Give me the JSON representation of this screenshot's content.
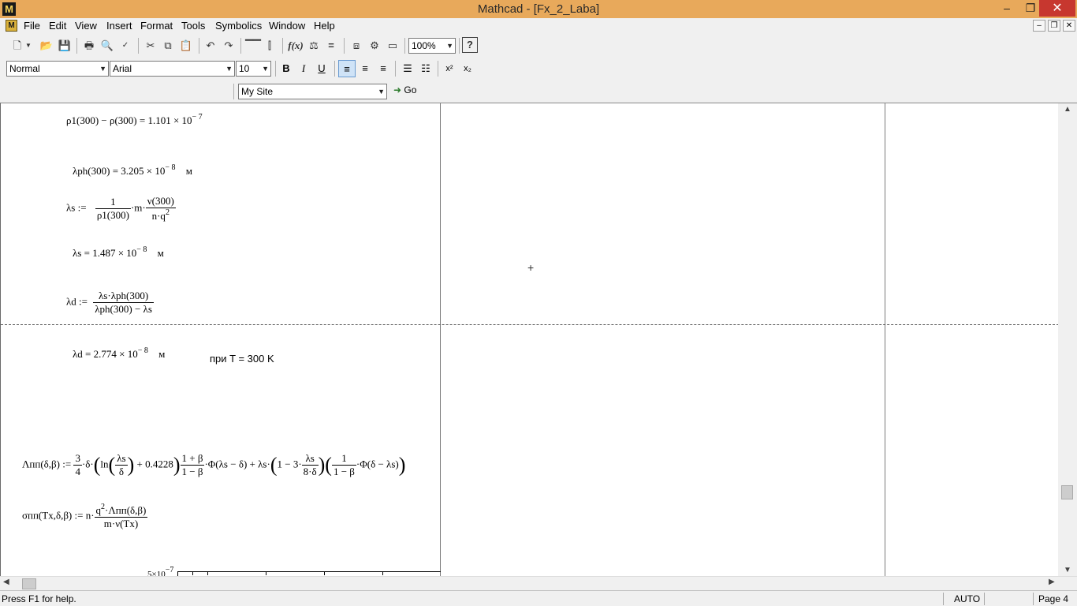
{
  "window": {
    "title": "Mathcad - [Fx_2_Laba]",
    "app_icon": "M",
    "controls": {
      "minimize": "–",
      "maximize": "❐",
      "close": "✕"
    }
  },
  "menu": {
    "doc_icon": "M",
    "items": [
      "File",
      "Edit",
      "View",
      "Insert",
      "Format",
      "Tools",
      "Symbolics",
      "Window",
      "Help"
    ],
    "mdi": {
      "minimize": "–",
      "restore": "❐",
      "close": "✕"
    }
  },
  "toolbar": {
    "icons": [
      "new-icon",
      "dropdown-icon",
      "open-icon",
      "save-icon",
      "print-icon",
      "print-preview-icon",
      "spell-check-icon",
      "cut-icon",
      "copy-icon",
      "paste-icon",
      "undo-icon",
      "redo-icon",
      "align-across-icon",
      "align-down-icon",
      "insert-function-icon",
      "insert-unit-icon",
      "calculate-icon",
      "insert-component-icon",
      "resource-center-icon",
      "help-icon"
    ],
    "zoom": "100%"
  },
  "format_bar": {
    "style": "Normal",
    "font": "Arial",
    "size": "10",
    "bold": "B",
    "italic": "I",
    "underline": "U",
    "superscript": "x²",
    "subscript": "x₂"
  },
  "web_bar": {
    "site": "My Site",
    "go_label": "Go"
  },
  "document": {
    "eq1_text": "ρ1(300) − ρ(300) = 1.101 × 10",
    "eq1_exp": "− 7",
    "eq2_text": "λph(300) = 3.205 × 10",
    "eq2_exp": "− 8",
    "eq2_unit": "м",
    "eq3_lhs": "λs :=",
    "eq3_num1": "1",
    "eq3_den1": "ρ1(300)",
    "eq3_mid": "·m·",
    "eq3_num2": "ν(300)",
    "eq3_den2": "n·q",
    "eq3_den2_exp": "2",
    "eq4_text": "λs = 1.487 × 10",
    "eq4_exp": "− 8",
    "eq4_unit": "м",
    "eq5_lhs": "λd :=",
    "eq5_num": "λs·λph(300)",
    "eq5_den": "λph(300) − λs",
    "eq6_text": "λd = 2.774 × 10",
    "eq6_exp": "− 8",
    "eq6_unit": "м",
    "note": "при T = 300 K",
    "eq7_lhs": "Λпп(δ,β) :=",
    "eq7_f1_num": "3",
    "eq7_f1_den": "4",
    "eq7_p1": "·δ·",
    "eq7_ln": "ln",
    "eq7_f2_num": "λs",
    "eq7_f2_den": "δ",
    "eq7_p2": "+ 0.4228",
    "eq7_f3_num": "1 + β",
    "eq7_f3_den": "1 − β",
    "eq7_p3": "·Φ(λs − δ) + λs·",
    "eq7_p4": "1 − 3·",
    "eq7_f4_num": "λs",
    "eq7_f4_den": "8·δ",
    "eq7_f5_num": "1",
    "eq7_f5_den": "1 − β",
    "eq7_p5": "·Φ(δ − λs)",
    "eq8_lhs": "σпп(Tx,δ,β) := n·",
    "eq8_num": "q",
    "eq8_num_exp": "2",
    "eq8_num_rest": "·Λпп(δ,β)",
    "eq8_den": "m·ν(Tx)",
    "plot_label": "5×10",
    "plot_label_exp": "−7",
    "cursor": "+"
  },
  "status": {
    "help": "Press F1 for help.",
    "mode": "AUTO",
    "page": "Page 4"
  }
}
